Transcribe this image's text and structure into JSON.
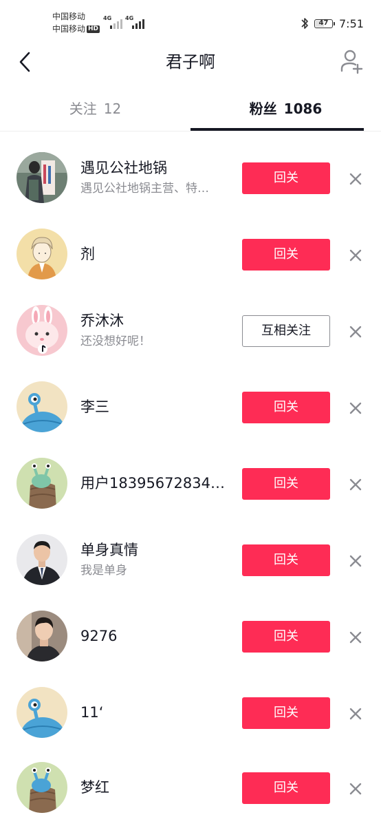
{
  "status_bar": {
    "carrier1": "中国移动",
    "carrier2": "中国移动",
    "hd": "HD",
    "net1": "4G",
    "net2": "4G",
    "battery": "47",
    "time": "7:51"
  },
  "header": {
    "title": "君子啊",
    "back_icon": "chevron-left-icon",
    "add_icon": "add-user-icon"
  },
  "tabs": [
    {
      "label": "关注",
      "count": "12",
      "active": false
    },
    {
      "label": "粉丝",
      "count": "1086",
      "active": true
    }
  ],
  "followers": [
    {
      "name": "遇见公社地锅",
      "desc": "遇见公社地锅主营、特…",
      "button": "回关",
      "style": "red"
    },
    {
      "name": "剂",
      "desc": "",
      "button": "回关",
      "style": "red"
    },
    {
      "name": "乔沐沐",
      "desc": "还没想好呢！",
      "button": "互相关注",
      "style": "outline"
    },
    {
      "name": "李三",
      "desc": "",
      "button": "回关",
      "style": "red"
    },
    {
      "name": "用户18395672834…",
      "desc": "",
      "button": "回关",
      "style": "red"
    },
    {
      "name": "单身真情",
      "desc": "我是单身",
      "button": "回关",
      "style": "red"
    },
    {
      "name": "9276",
      "desc": "",
      "button": "回关",
      "style": "red"
    },
    {
      "name": "11‘",
      "desc": "",
      "button": "回关",
      "style": "red"
    },
    {
      "name": "梦红",
      "desc": "",
      "button": "回关",
      "style": "red"
    }
  ],
  "colors": {
    "accent": "#fe2c55",
    "text": "#161823",
    "secondary": "#8a8b91"
  }
}
